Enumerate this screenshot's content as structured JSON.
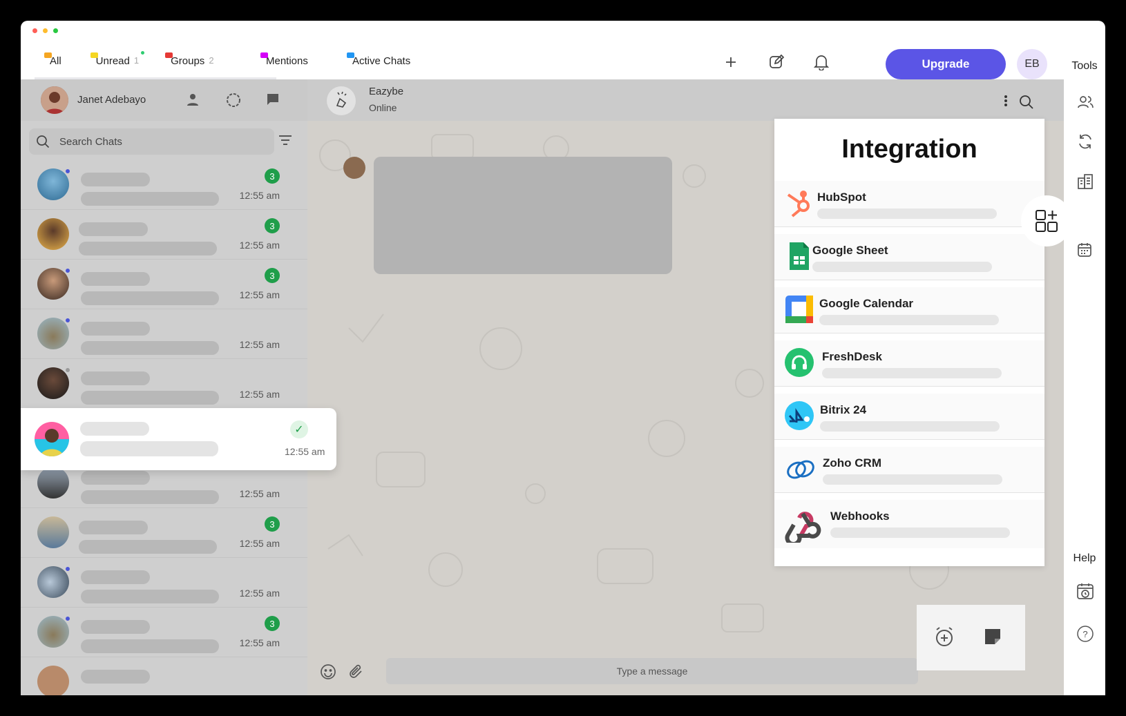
{
  "tabs": [
    {
      "label": "All",
      "flag_color": "#f5a623",
      "active": true
    },
    {
      "label": "Unread",
      "count": "1",
      "flag_color": "#f5d623"
    },
    {
      "label": "Groups",
      "count": "2",
      "flag_color": "#e53935"
    },
    {
      "label": "Mentions",
      "flag_color": "#d500f9"
    },
    {
      "label": "Active Chats",
      "flag_color": "#2196f3"
    }
  ],
  "header": {
    "upgrade_label": "Upgrade",
    "avatar_initials": "EB"
  },
  "rail": {
    "tools_label": "Tools",
    "help_label": "Help"
  },
  "profile": {
    "name": "Janet Adebayo"
  },
  "search": {
    "placeholder": "Search Chats"
  },
  "chats": [
    {
      "time": "12:55 am",
      "badge": "3"
    },
    {
      "time": "12:55 am",
      "badge": "3"
    },
    {
      "time": "12:55 am",
      "badge": "3"
    },
    {
      "time": "12:55 am",
      "badge": ""
    },
    {
      "time": "12:55 am",
      "badge": ""
    },
    {
      "time": "12:55 am",
      "badge": ""
    },
    {
      "time": "12:55 am",
      "badge": "3"
    },
    {
      "time": "12:55 am",
      "badge": ""
    },
    {
      "time": "12:55 am",
      "badge": "3"
    }
  ],
  "selected_chat": {
    "time": "12:55 am"
  },
  "contact": {
    "name": "Eazybe",
    "status": "Online"
  },
  "composer": {
    "placeholder": "Type a message"
  },
  "integration": {
    "title": "Integration",
    "items": [
      {
        "name": "HubSpot",
        "icon": "hubspot-icon"
      },
      {
        "name": "Google Sheet",
        "icon": "google-sheet-icon"
      },
      {
        "name": "Google Calendar",
        "icon": "google-calendar-icon"
      },
      {
        "name": "FreshDesk",
        "icon": "freshdesk-icon"
      },
      {
        "name": "Bitrix 24",
        "icon": "bitrix24-icon"
      },
      {
        "name": "Zoho CRM",
        "icon": "zoho-crm-icon"
      },
      {
        "name": "Webhooks",
        "icon": "webhooks-icon"
      }
    ]
  },
  "colors": {
    "accent": "#5b55e6",
    "badge_green": "#1f9e4a"
  }
}
